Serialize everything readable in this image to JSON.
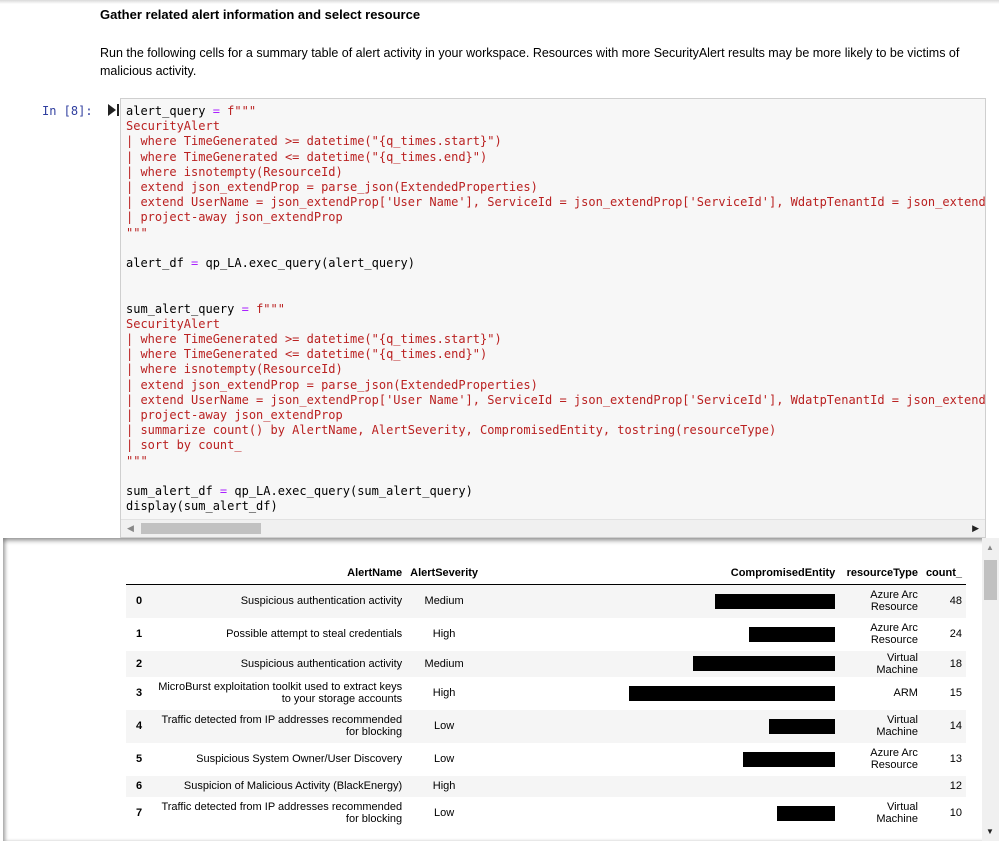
{
  "markdown": {
    "heading": "Gather related alert information and select resource",
    "paragraph": "Run the following cells for a summary table of alert activity in your workspace. Resources with more SecurityAlert results may be more likely to be victims of malicious activity."
  },
  "cell": {
    "prompt": "In [8]:",
    "code_lines": [
      "alert_query = f\"\"\"",
      "SecurityAlert",
      "| where TimeGenerated >= datetime(\"{q_times.start}\")",
      "| where TimeGenerated <= datetime(\"{q_times.end}\")",
      "| where isnotempty(ResourceId)",
      "| extend json_extendProp = parse_json(ExtendedProperties)",
      "| extend UserName = json_extendProp['User Name'], ServiceId = json_extendProp['ServiceId'], WdatpTenantId = json_extendProp['",
      "| project-away json_extendProp",
      "\"\"\"",
      "",
      "alert_df = qp_LA.exec_query(alert_query)",
      "",
      "",
      "sum_alert_query = f\"\"\"",
      "SecurityAlert",
      "| where TimeGenerated >= datetime(\"{q_times.start}\")",
      "| where TimeGenerated <= datetime(\"{q_times.end}\")",
      "| where isnotempty(ResourceId)",
      "| extend json_extendProp = parse_json(ExtendedProperties)",
      "| extend UserName = json_extendProp['User Name'], ServiceId = json_extendProp['ServiceId'], WdatpTenantId = json_extendProp['",
      "| project-away json_extendProp",
      "| summarize count() by AlertName, AlertSeverity, CompromisedEntity, tostring(resourceType)",
      "| sort by count_",
      "\"\"\"",
      "",
      "sum_alert_df = qp_LA.exec_query(sum_alert_query)",
      "display(sum_alert_df)"
    ]
  },
  "output_table": {
    "columns": [
      "",
      "AlertName",
      "AlertSeverity",
      "CompromisedEntity",
      "resourceType",
      "count_"
    ],
    "rows": [
      {
        "index": "0",
        "alert_name": "Suspicious authentication activity",
        "severity": "Medium",
        "entity_redacted": true,
        "resource_type": "Azure Arc Resource",
        "count": "48"
      },
      {
        "index": "1",
        "alert_name": "Possible attempt to steal credentials",
        "severity": "High",
        "entity_redacted": true,
        "resource_type": "Azure Arc Resource",
        "count": "24"
      },
      {
        "index": "2",
        "alert_name": "Suspicious authentication activity",
        "severity": "Medium",
        "entity_redacted": true,
        "resource_type": "Virtual Machine",
        "count": "18"
      },
      {
        "index": "3",
        "alert_name": "MicroBurst exploitation toolkit used to extract keys to your storage accounts",
        "severity": "High",
        "entity_redacted": true,
        "resource_type": "ARM",
        "count": "15"
      },
      {
        "index": "4",
        "alert_name": "Traffic detected from IP addresses recommended for blocking",
        "severity": "Low",
        "entity_redacted": true,
        "resource_type": "Virtual Machine",
        "count": "14"
      },
      {
        "index": "5",
        "alert_name": "Suspicious System Owner/User Discovery",
        "severity": "Low",
        "entity_redacted": true,
        "resource_type": "Azure Arc Resource",
        "count": "13"
      },
      {
        "index": "6",
        "alert_name": "Suspicion of Malicious Activity (BlackEnergy)",
        "severity": "High",
        "entity_redacted": false,
        "resource_type": "",
        "count": "12"
      },
      {
        "index": "7",
        "alert_name": "Traffic detected from IP addresses recommended for blocking",
        "severity": "Low",
        "entity_redacted": true,
        "resource_type": "Virtual Machine",
        "count": "10"
      }
    ]
  },
  "colors": {
    "prompt": "#303f9f",
    "string": "#ba2121",
    "operator": "#aa22ff",
    "cell_background": "#f7f7f7",
    "stripe": "#f5f5f5"
  },
  "icons": {
    "run_indicator": "run-cursor-icon",
    "scroll_left": "scroll-left-arrow-icon",
    "scroll_right": "scroll-right-arrow-icon",
    "scroll_up": "scroll-up-arrow-icon",
    "scroll_down": "scroll-down-arrow-icon"
  }
}
